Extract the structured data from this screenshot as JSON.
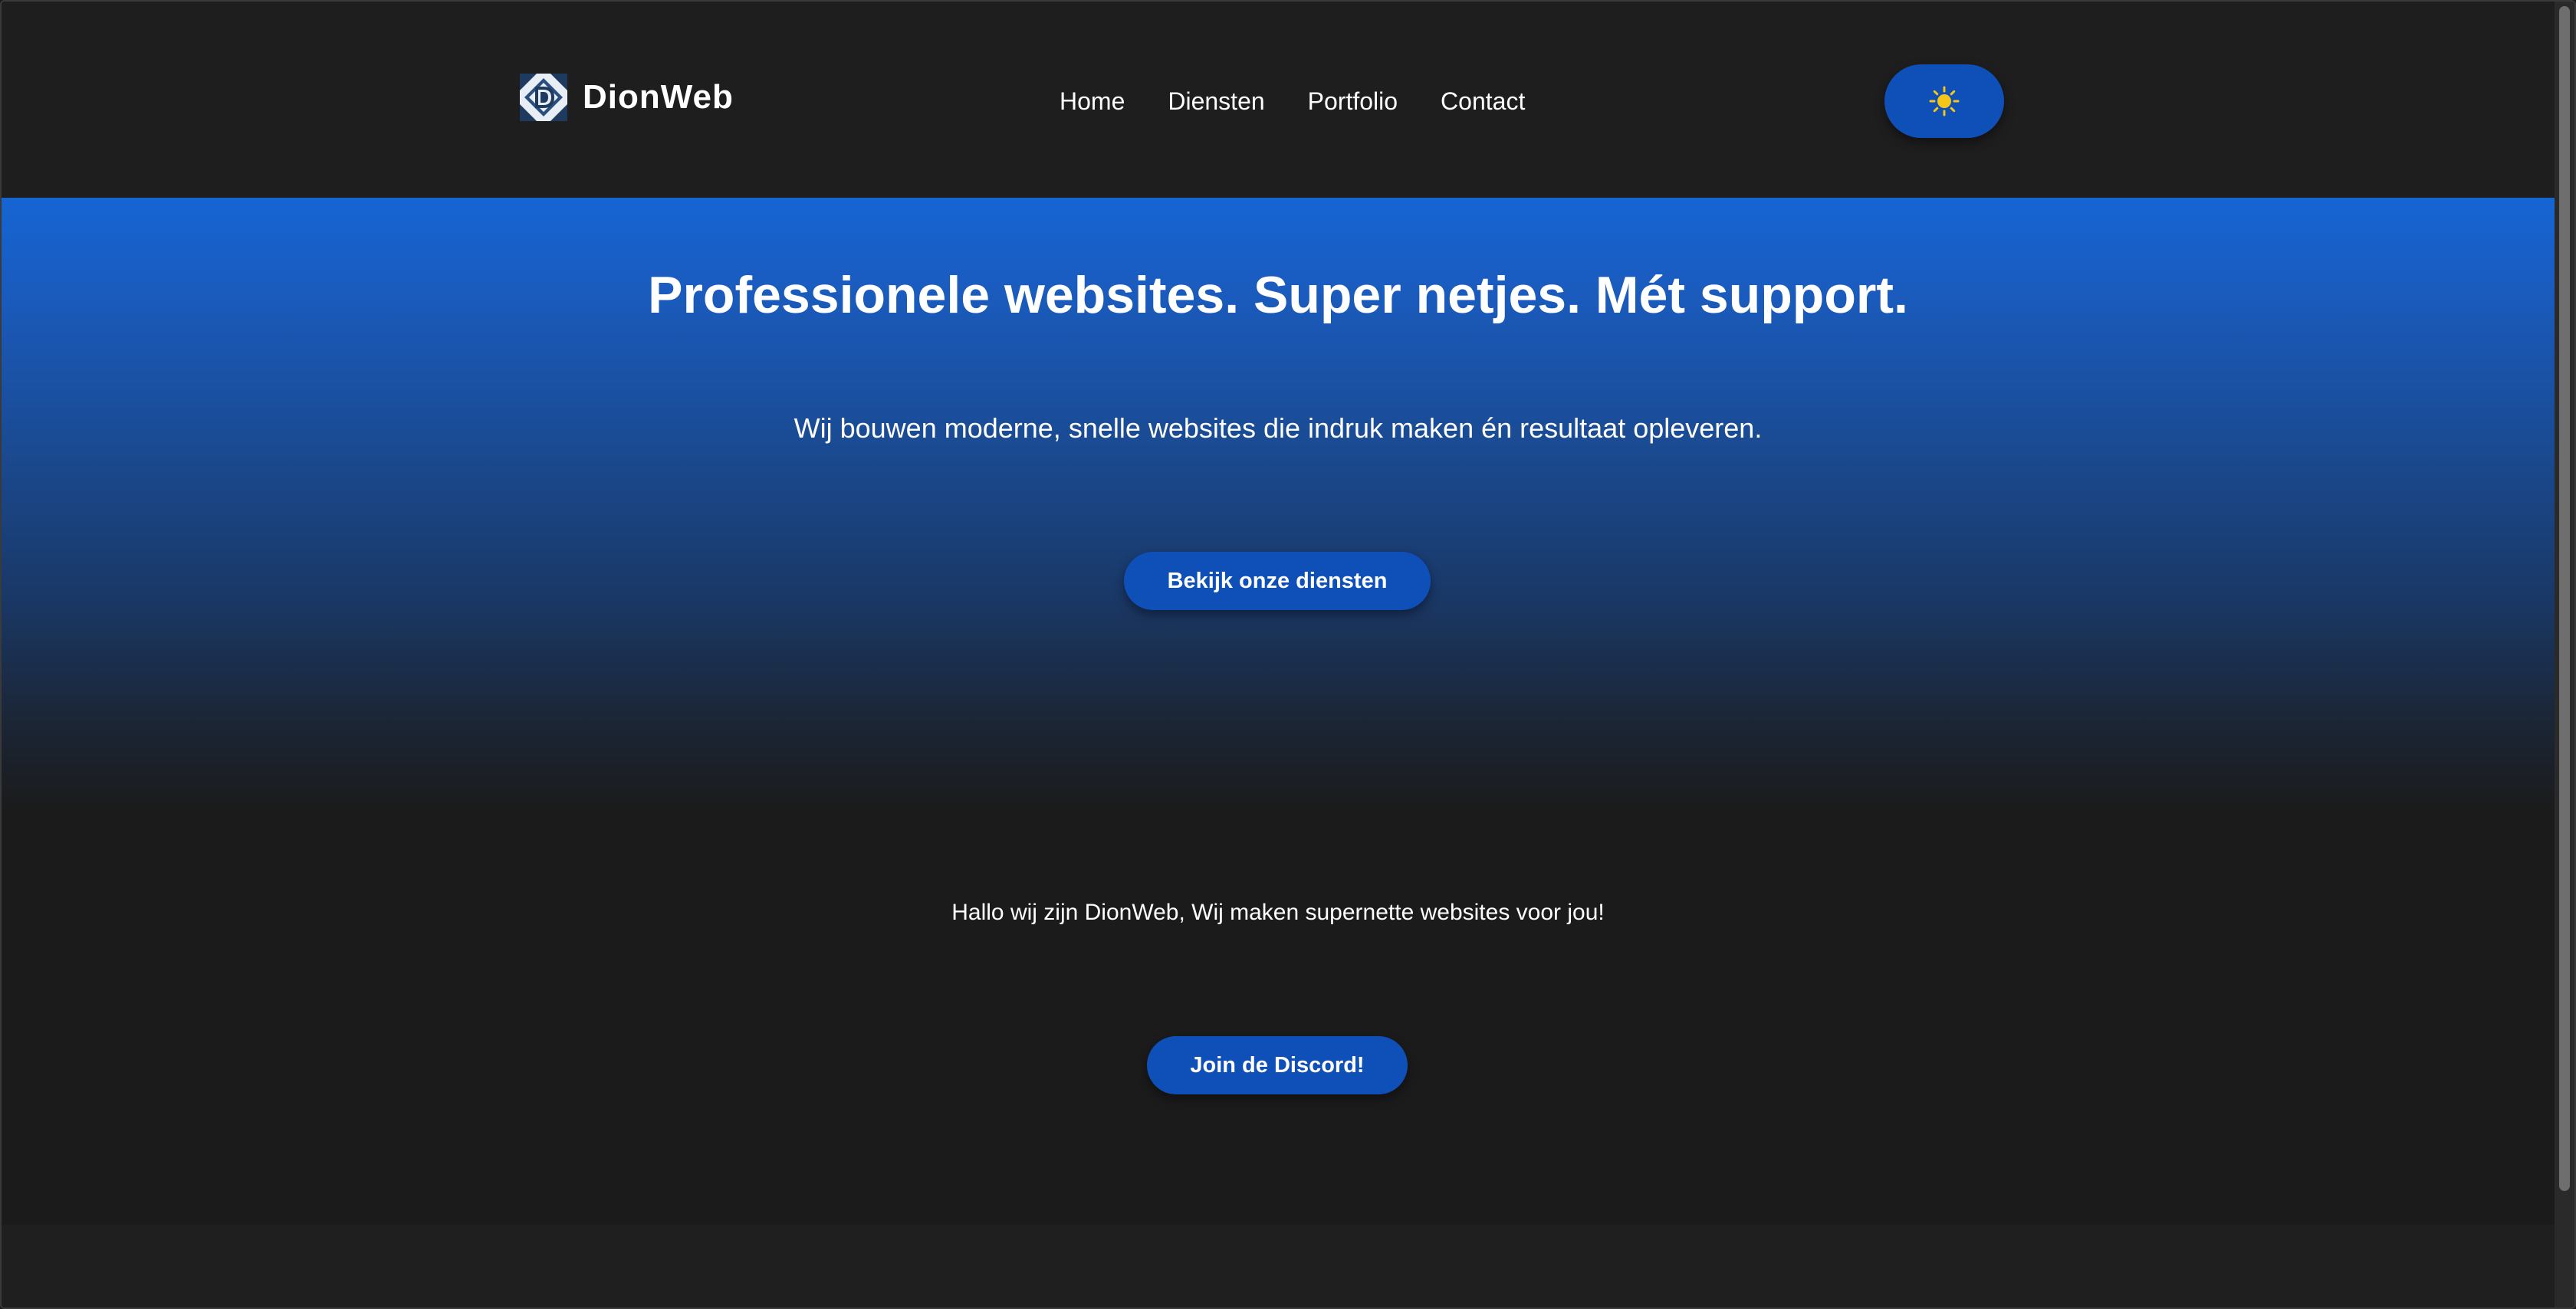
{
  "header": {
    "brand_name": "DionWeb",
    "nav": [
      {
        "label": "Home"
      },
      {
        "label": "Diensten"
      },
      {
        "label": "Portfolio"
      },
      {
        "label": "Contact"
      }
    ],
    "theme_toggle_icon": "sun-icon"
  },
  "hero": {
    "title": "Professionele websites. Super netjes. Mét support.",
    "subtitle": "Wij bouwen moderne, snelle websites die indruk maken én resultaat opleveren.",
    "cta_label": "Bekijk onze diensten"
  },
  "intro": {
    "text": "Hallo wij zijn DionWeb, Wij maken supernette websites voor jou!",
    "cta_label": "Join de Discord!"
  },
  "colors": {
    "background": "#1b1b1b",
    "header_background": "#1e1e1e",
    "accent": "#0f50b8",
    "hero_gradient_top": "#1565d3",
    "text": "#ffffff",
    "sun": "#f5c518"
  }
}
